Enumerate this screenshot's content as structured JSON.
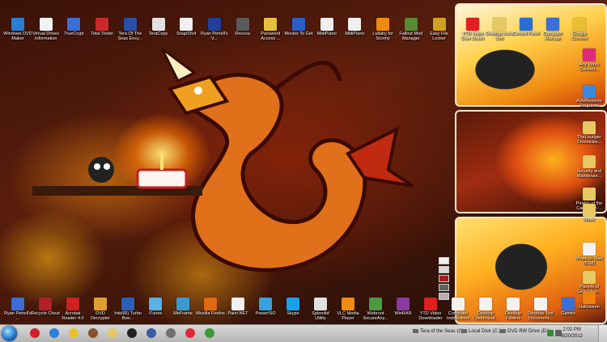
{
  "top_row_icons": [
    {
      "label": "Windows DVD Maker",
      "icon": "dvd-maker-icon",
      "color": "#2a7fd4"
    },
    {
      "label": "Virtual Drives Information",
      "icon": "document-icon",
      "color": "#f2f2f2"
    },
    {
      "label": "TrueCrypt",
      "icon": "truecrypt-icon",
      "color": "#3a6fd8"
    },
    {
      "label": "Total Tester",
      "icon": "tester-icon",
      "color": "#cc2a2a"
    },
    {
      "label": "Tera Of The Seas Ency...",
      "icon": "tera-icon",
      "color": "#2a4fa8"
    },
    {
      "label": "TeraCopy",
      "icon": "teracopy-icon",
      "color": "#e0e0e0"
    },
    {
      "label": "SnapShot",
      "icon": "snapshot-icon",
      "color": "#f0f0f0"
    },
    {
      "label": "Ryan Petrell's V...",
      "icon": "document-icon",
      "color": "#1f3f9a"
    },
    {
      "label": "Recuva",
      "icon": "recuva-icon",
      "color": "#5a5a5a"
    },
    {
      "label": "Password Access ...",
      "icon": "lock-icon",
      "color": "#e8c040"
    },
    {
      "label": "Movies To Get",
      "icon": "word-doc-icon",
      "color": "#2a5fc8"
    },
    {
      "label": "MidiPiano",
      "icon": "piano-icon",
      "color": "#f0f0f0"
    },
    {
      "label": "MidiPiano",
      "icon": "piano-icon",
      "color": "#f0f0f0"
    },
    {
      "label": "Lullaby for Stormy",
      "icon": "vlc-cone-icon",
      "color": "#f08a10"
    },
    {
      "label": "Fallout Mod Manager",
      "icon": "fallout-icon",
      "color": "#5a8a30"
    },
    {
      "label": "Easy File Locker",
      "icon": "lock-icon",
      "color": "#d0a020"
    }
  ],
  "bottom_row_icons": [
    {
      "label": "Ryan Petrell's ...",
      "icon": "computer-icon",
      "color": "#3a6fd8"
    },
    {
      "label": "Recycle Chest",
      "icon": "recycle-chest-icon",
      "color": "#b0202a"
    },
    {
      "label": "Acrobat Reader 4.0",
      "icon": "acrobat-icon",
      "color": "#d02020"
    },
    {
      "label": "DVD Decrypter",
      "icon": "dvd-icon",
      "color": "#e0a030"
    },
    {
      "label": "Intel(R) Turbo Boo...",
      "icon": "intel-icon",
      "color": "#2a5fb8"
    },
    {
      "label": "iTunes",
      "icon": "itunes-icon",
      "color": "#5ab0e8"
    },
    {
      "label": "MeFrame",
      "icon": "frame-icon",
      "color": "#3a9ad0"
    },
    {
      "label": "Mozilla Firefox",
      "icon": "firefox-icon",
      "color": "#e06a10"
    },
    {
      "label": "Paint.NET",
      "icon": "paint-icon",
      "color": "#f0f0f0"
    },
    {
      "label": "PowerISO",
      "icon": "poweriso-icon",
      "color": "#3aa0e0"
    },
    {
      "label": "Skype",
      "icon": "skype-icon",
      "color": "#1aa0e8"
    },
    {
      "label": "Splendid Utility",
      "icon": "splendid-icon",
      "color": "#e0e0e0"
    },
    {
      "label": "VLC Media Player",
      "icon": "vlc-cone-icon",
      "color": "#f08a10"
    },
    {
      "label": "Webroot SecureAny...",
      "icon": "webroot-icon",
      "color": "#4a9a40"
    },
    {
      "label": "WinRAR",
      "icon": "winrar-icon",
      "color": "#8a3aa0"
    },
    {
      "label": "YTD Video Downloader",
      "icon": "ytd-icon",
      "color": "#e02020"
    },
    {
      "label": "Computer Instructions",
      "icon": "document-icon",
      "color": "#f2f2f2"
    },
    {
      "label": "Desktop Customizat...",
      "icon": "document-icon",
      "color": "#f2f2f2"
    },
    {
      "label": "Desktop Folders",
      "icon": "document-icon",
      "color": "#f2f2f2"
    },
    {
      "label": "Desktop Text Document...",
      "icon": "document-icon",
      "color": "#f2f2f2"
    },
    {
      "label": "Games",
      "icon": "games-icon",
      "color": "#3a6fd8"
    }
  ],
  "panel_top_icons": [
    {
      "label": "YTD Video Dow Studio",
      "icon": "ytd-icon",
      "color": "#e02020"
    },
    {
      "label": "Desktop Icons Sort",
      "icon": "folder-icon",
      "color": "#e8c860"
    },
    {
      "label": "Control Panel",
      "icon": "control-panel-icon",
      "color": "#2a6fd0"
    },
    {
      "label": "Computer Manage",
      "icon": "computer-icon",
      "color": "#3a6fd8"
    },
    {
      "label": "Google Chrome",
      "icon": "chrome-icon",
      "color": "#e8c030"
    }
  ],
  "right_column_icons": [
    {
      "label": "Any Video Convert...",
      "icon": "converter-icon",
      "color": "#e02a7a"
    },
    {
      "label": "Add/Remove Programs",
      "icon": "programs-icon",
      "color": "#3a8ae0"
    },
    {
      "label": "TheLoudger Chronicles...",
      "icon": "folder-icon",
      "color": "#e8c860"
    },
    {
      "label": "Security and Maintenan...",
      "icon": "folder-icon",
      "color": "#e8c860"
    },
    {
      "label": "Pirates of the Caribbean ...",
      "icon": "folder-icon",
      "color": "#e8c860"
    },
    {
      "label": "Music",
      "icon": "music-folder-icon",
      "color": "#e8c860"
    },
    {
      "label": "Movie to Start (0.08)",
      "icon": "document-icon",
      "color": "#f2f2f2"
    },
    {
      "label": "Planets of Gem Mine...",
      "icon": "folder-icon",
      "color": "#e8c860"
    },
    {
      "label": "Halloween",
      "icon": "pumpkin-icon",
      "color": "#f08010"
    }
  ],
  "swatches": [
    "#f0f0f0",
    "#d8d8d8",
    "#a02020",
    "#606060",
    "#b0b0b0"
  ],
  "taskbar": {
    "start": "start-orb-icon",
    "pinned": [
      {
        "icon": "flag-icon",
        "color": "#d0202a"
      },
      {
        "icon": "ie-icon",
        "color": "#2a80d8"
      },
      {
        "icon": "chrome-icon",
        "color": "#e8c030"
      },
      {
        "icon": "avatar-icon",
        "color": "#8a5030"
      },
      {
        "icon": "explorer-icon",
        "color": "#e8c860"
      },
      {
        "icon": "d-icon",
        "color": "#222222"
      },
      {
        "icon": "ball-icon",
        "color": "#3a5aa8"
      },
      {
        "icon": "wolf-icon",
        "color": "#707070"
      },
      {
        "icon": "red-app-icon",
        "color": "#e02a3a"
      },
      {
        "icon": "media-player-icon",
        "color": "#3a9a3a"
      }
    ],
    "drives": [
      {
        "label": "Tera of the Seas (G)"
      },
      {
        "label": "Local Disk (C:)"
      },
      {
        "label": "DVD RW Drive (D:)"
      }
    ],
    "time": "2:02 PM",
    "date": "9/20/2012"
  }
}
